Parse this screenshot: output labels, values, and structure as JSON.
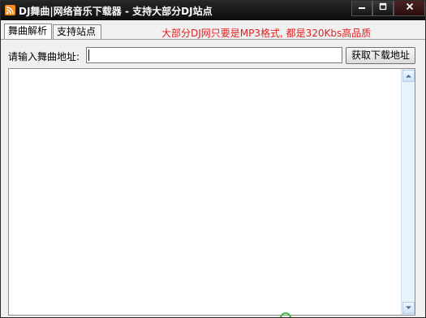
{
  "window": {
    "title": "DJ舞曲|网络音乐下载器 - 支持大部分DJ站点",
    "icon": "rss-icon",
    "controls": {
      "minimize": "minimize-icon",
      "maximize": "maximize-icon",
      "close": "close-icon"
    }
  },
  "tabs": [
    {
      "label": "舞曲解析",
      "active": true
    },
    {
      "label": "支持站点",
      "active": false
    }
  ],
  "notice": "大部分DJ网只要是MP3格式, 都是320Kbs高品质",
  "address": {
    "label": "请输入舞曲地址:",
    "value": "",
    "button_label": "获取下载地址"
  },
  "colors": {
    "titlebar": "#1a1a1a",
    "notice_text": "#e02020",
    "scrollbar": "#e8f2fb"
  }
}
